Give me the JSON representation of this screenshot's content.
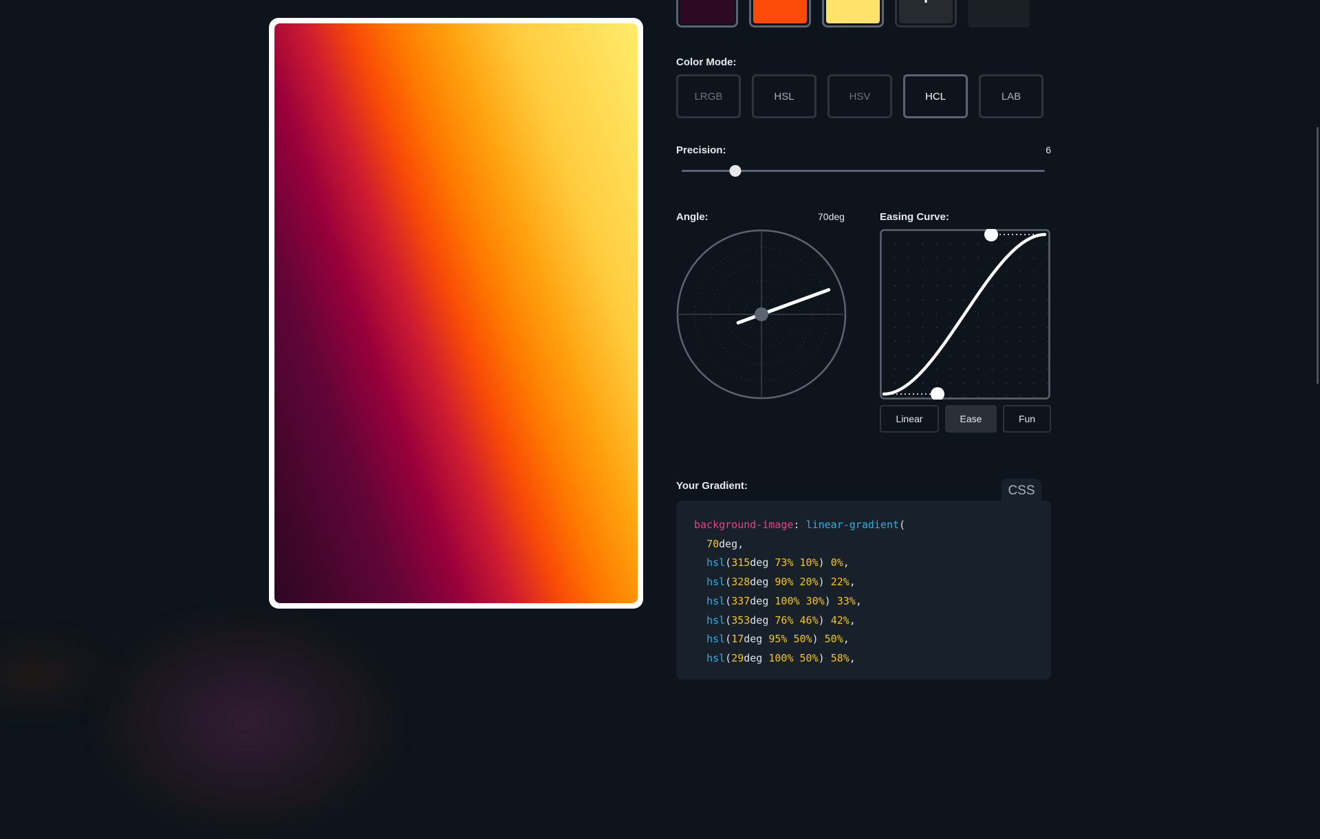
{
  "swatches": [
    {
      "name": "color-stop-1",
      "color": "#2d0922"
    },
    {
      "name": "color-stop-2",
      "color": "#fc4b08"
    },
    {
      "name": "color-stop-3",
      "color": "#ffe26a"
    }
  ],
  "add_color_label": "+",
  "color_mode": {
    "label": "Color Mode:",
    "options": [
      "LRGB",
      "HSL",
      "HSV",
      "HCL",
      "LAB"
    ],
    "selected": "HCL"
  },
  "precision": {
    "label": "Precision:",
    "value": "6",
    "min": 1,
    "max": 20,
    "current": 6
  },
  "angle": {
    "label": "Angle:",
    "value": "70deg",
    "degrees": 70
  },
  "easing": {
    "label": "Easing Curve:",
    "options": [
      "Linear",
      "Ease",
      "Fun"
    ],
    "selected": "Ease"
  },
  "output": {
    "label": "Your Gradient:",
    "tab": "CSS",
    "property": "background-image",
    "function": "linear-gradient",
    "angle_num": "70",
    "angle_unit": "deg",
    "stops": [
      {
        "h": "315",
        "s": "73%",
        "l": "10%",
        "pos": "0%"
      },
      {
        "h": "328",
        "s": "90%",
        "l": "20%",
        "pos": "22%"
      },
      {
        "h": "337",
        "s": "100%",
        "l": "30%",
        "pos": "33%"
      },
      {
        "h": "353",
        "s": "76%",
        "l": "46%",
        "pos": "42%"
      },
      {
        "h": "17",
        "s": "95%",
        "l": "50%",
        "pos": "50%"
      },
      {
        "h": "29",
        "s": "100%",
        "l": "50%",
        "pos": "58%"
      }
    ]
  },
  "preview": {
    "gradient": "linear-gradient(70deg, hsl(315deg 73% 10%) 0%, hsl(328deg 90% 20%) 22%, hsl(337deg 100% 30%) 33%, hsl(353deg 76% 46%) 42%, hsl(17deg 95% 50%) 50%, hsl(29deg 100% 50%) 58%, hsl(37deg 100% 53%) 67%, hsl(44deg 100% 62%) 78%, hsl(52deg 100% 71%) 100%)"
  }
}
